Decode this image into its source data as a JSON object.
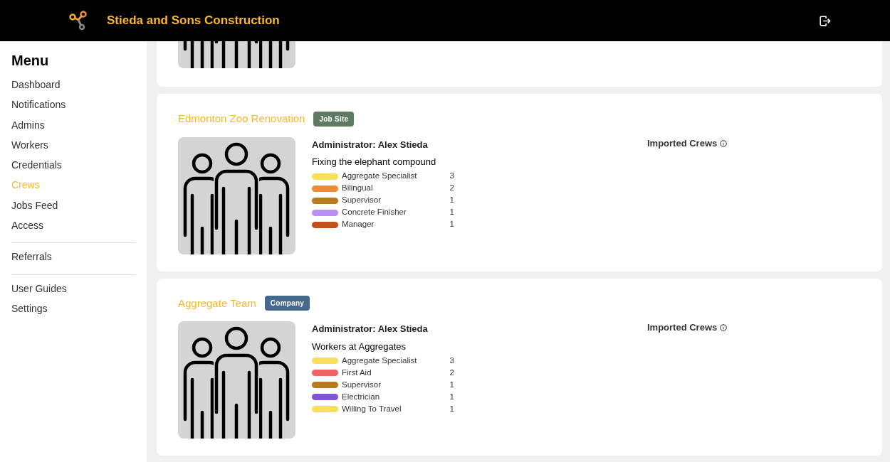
{
  "header": {
    "company": "Stieda and Sons Construction"
  },
  "sidebar": {
    "title": "Menu",
    "groups": [
      {
        "items": [
          {
            "label": "Dashboard",
            "selected": false
          },
          {
            "label": "Notifications",
            "selected": false
          },
          {
            "label": "Admins",
            "selected": false
          },
          {
            "label": "Workers",
            "selected": false
          },
          {
            "label": "Credentials",
            "selected": false
          },
          {
            "label": "Crews",
            "selected": true
          },
          {
            "label": "Jobs Feed",
            "selected": false
          },
          {
            "label": "Access",
            "selected": false
          }
        ]
      },
      {
        "items": [
          {
            "label": "Referrals",
            "selected": false
          }
        ]
      },
      {
        "items": [
          {
            "label": "User Guides",
            "selected": false
          },
          {
            "label": "Settings",
            "selected": false
          }
        ]
      }
    ]
  },
  "crews": [
    {
      "name": "Edmonton Zoo Renovation",
      "badge": {
        "label": "Job Site",
        "kind": "job_site"
      },
      "administrator": "Administrator: Alex Stieda",
      "description": "Fixing the elephant compound",
      "imported_label": "Imported Crews",
      "skills": [
        {
          "label": "Aggregate Specialist",
          "count": "3",
          "color": "#f8e05c"
        },
        {
          "label": "Bilingual",
          "count": "2",
          "color": "#ef8a38"
        },
        {
          "label": "Supervisor",
          "count": "1",
          "color": "#b87a1e"
        },
        {
          "label": "Concrete Finisher",
          "count": "1",
          "color": "#b891f3"
        },
        {
          "label": "Manager",
          "count": "1",
          "color": "#c0521e"
        }
      ]
    },
    {
      "name": "Aggregate Team",
      "badge": {
        "label": "Company",
        "kind": "company"
      },
      "administrator": "Administrator: Alex Stieda",
      "description": "Workers at Aggregates",
      "imported_label": "Imported Crews",
      "skills": [
        {
          "label": "Aggregate Specialist",
          "count": "3",
          "color": "#f8e05c"
        },
        {
          "label": "First Aid",
          "count": "2",
          "color": "#ef6464"
        },
        {
          "label": "Supervisor",
          "count": "1",
          "color": "#b87a1e"
        },
        {
          "label": "Electrician",
          "count": "1",
          "color": "#7f57d6"
        },
        {
          "label": "Willing To Travel",
          "count": "1",
          "color": "#f8e05c"
        }
      ]
    }
  ]
}
